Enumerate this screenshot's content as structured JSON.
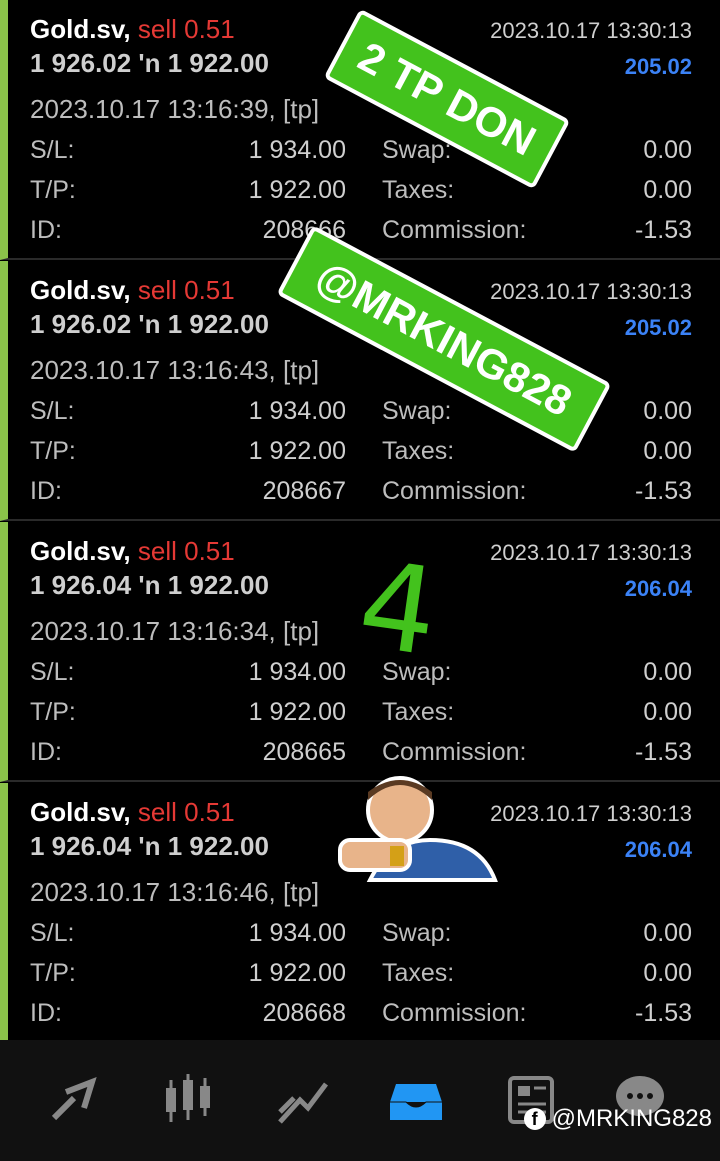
{
  "deals": [
    {
      "symbol": "Gold.sv,",
      "side": "sell 0.51",
      "prices": "1 926.02 'n  1 922.00",
      "timestamp": "2023.10.17 13:30:13",
      "profit": "205.02",
      "opened": "2023.10.17 13:16:39, [tp]",
      "sl_label": "S/L:",
      "sl": "1 934.00",
      "tp_label": "T/P:",
      "tp": "1 922.00",
      "id_label": "ID:",
      "id": "208666",
      "swap_label": "Swap:",
      "swap": "0.00",
      "taxes_label": "Taxes:",
      "taxes": "0.00",
      "commission_label": "Commission:",
      "commission": "-1.53"
    },
    {
      "symbol": "Gold.sv,",
      "side": "sell 0.51",
      "prices": "1 926.02 'n  1 922.00",
      "timestamp": "2023.10.17 13:30:13",
      "profit": "205.02",
      "opened": "2023.10.17 13:16:43, [tp]",
      "sl_label": "S/L:",
      "sl": "1 934.00",
      "tp_label": "T/P:",
      "tp": "1 922.00",
      "id_label": "ID:",
      "id": "208667",
      "swap_label": "Swap:",
      "swap": "0.00",
      "taxes_label": "Taxes:",
      "taxes": "0.00",
      "commission_label": "Commission:",
      "commission": "-1.53"
    },
    {
      "symbol": "Gold.sv,",
      "side": "sell 0.51",
      "prices": "1 926.04 'n  1 922.00",
      "timestamp": "2023.10.17 13:30:13",
      "profit": "206.04",
      "opened": "2023.10.17 13:16:34, [tp]",
      "sl_label": "S/L:",
      "sl": "1 934.00",
      "tp_label": "T/P:",
      "tp": "1 922.00",
      "id_label": "ID:",
      "id": "208665",
      "swap_label": "Swap:",
      "swap": "0.00",
      "taxes_label": "Taxes:",
      "taxes": "0.00",
      "commission_label": "Commission:",
      "commission": "-1.53"
    },
    {
      "symbol": "Gold.sv,",
      "side": "sell 0.51",
      "prices": "1 926.04 'n  1 922.00",
      "timestamp": "2023.10.17 13:30:13",
      "profit": "206.04",
      "opened": "2023.10.17 13:16:46, [tp]",
      "sl_label": "S/L:",
      "sl": "1 934.00",
      "tp_label": "T/P:",
      "tp": "1 922.00",
      "id_label": "ID:",
      "id": "208668",
      "swap_label": "Swap:",
      "swap": "0.00",
      "taxes_label": "Taxes:",
      "taxes": "0.00",
      "commission_label": "Commission:",
      "commission": "-1.53"
    }
  ],
  "stickers": {
    "tp_done": "2 TP DON",
    "handle": "@MRKING828",
    "handwritten": "4"
  },
  "watermark": "@MRKING828",
  "colors": {
    "accent_bar": "#8bc34a",
    "sell": "#e53935",
    "profit": "#3b82f6",
    "sticker": "#43c21d",
    "nav_active": "#2196f3"
  },
  "nav": {
    "items": [
      {
        "icon": "quotes-icon"
      },
      {
        "icon": "chart-icon"
      },
      {
        "icon": "trade-icon"
      },
      {
        "icon": "history-icon",
        "active": true
      },
      {
        "icon": "news-icon"
      },
      {
        "icon": "chat-icon"
      }
    ]
  }
}
